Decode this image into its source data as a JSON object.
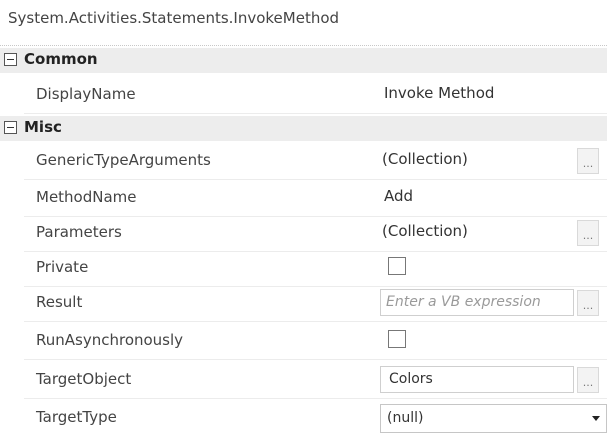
{
  "header": {
    "title": "System.Activities.Statements.InvokeMethod"
  },
  "categories": [
    {
      "label": "Common"
    },
    {
      "label": "Misc"
    }
  ],
  "properties": {
    "display_name": {
      "name": "DisplayName",
      "value": "Invoke Method"
    },
    "generic_type_arguments": {
      "name": "GenericTypeArguments",
      "value": "(Collection)",
      "button": "..."
    },
    "method_name": {
      "name": "MethodName",
      "value": "Add"
    },
    "parameters": {
      "name": "Parameters",
      "value": "(Collection)",
      "button": "..."
    },
    "private": {
      "name": "Private",
      "checked": false
    },
    "result": {
      "name": "Result",
      "placeholder": "Enter a VB expression",
      "button": "..."
    },
    "run_asynchronously": {
      "name": "RunAsynchronously",
      "checked": false
    },
    "target_object": {
      "name": "TargetObject",
      "value": "Colors",
      "button": "..."
    },
    "target_type": {
      "name": "TargetType",
      "value": "(null)"
    }
  }
}
